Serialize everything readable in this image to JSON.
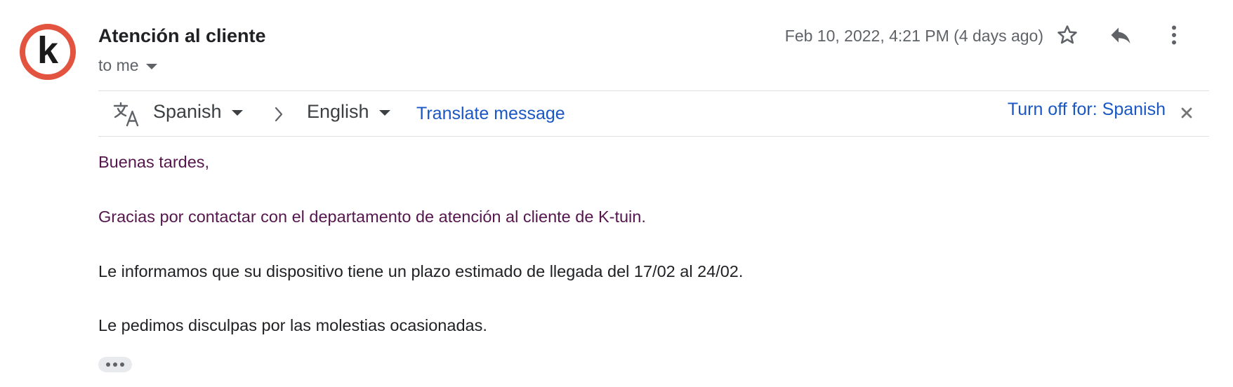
{
  "message": {
    "avatar_letter": "k",
    "sender_name": "Atención al cliente",
    "recipient_label": "to me",
    "date_label": "Feb 10, 2022, 4:21 PM (4 days ago)",
    "icons": {
      "star": "star-icon",
      "reply": "reply-icon",
      "more": "more-vert-icon"
    }
  },
  "translate": {
    "from_language": "Spanish",
    "to_language": "English",
    "translate_link": "Translate message",
    "turn_off_link": "Turn off for: Spanish",
    "icons": {
      "translate": "translate-icon",
      "arrow": "chevron-right-icon",
      "close": "close-icon"
    }
  },
  "body": {
    "lines": [
      "Buenas tardes,",
      "Gracias por contactar con el departamento de atención al cliente de K-tuin.",
      "Le informamos que su dispositivo tiene un plazo estimado de llegada del 17/02 al 24/02.",
      "Le pedimos disculpas por las molestias ocasionadas."
    ]
  },
  "colors": {
    "avatar_ring": "#e2543f",
    "link_blue": "#1a57c4",
    "visited_text": "#55164d"
  }
}
